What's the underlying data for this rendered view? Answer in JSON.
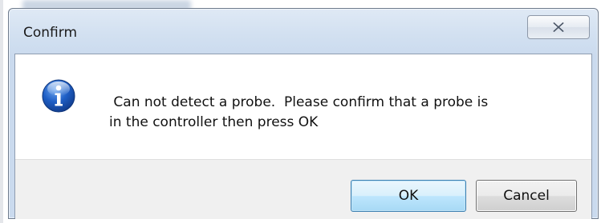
{
  "dialog": {
    "title": "Confirm",
    "close_icon": "close-x-icon",
    "message_icon": "info-icon",
    "message": " Can not detect a probe.  Please confirm that a probe is\nin the controller then press OK",
    "buttons": {
      "ok_label": "OK",
      "cancel_label": "Cancel"
    }
  },
  "colors": {
    "frame": "#cadaee",
    "ok_border": "#3c7fb1",
    "info_blue": "#1a5cc4"
  }
}
